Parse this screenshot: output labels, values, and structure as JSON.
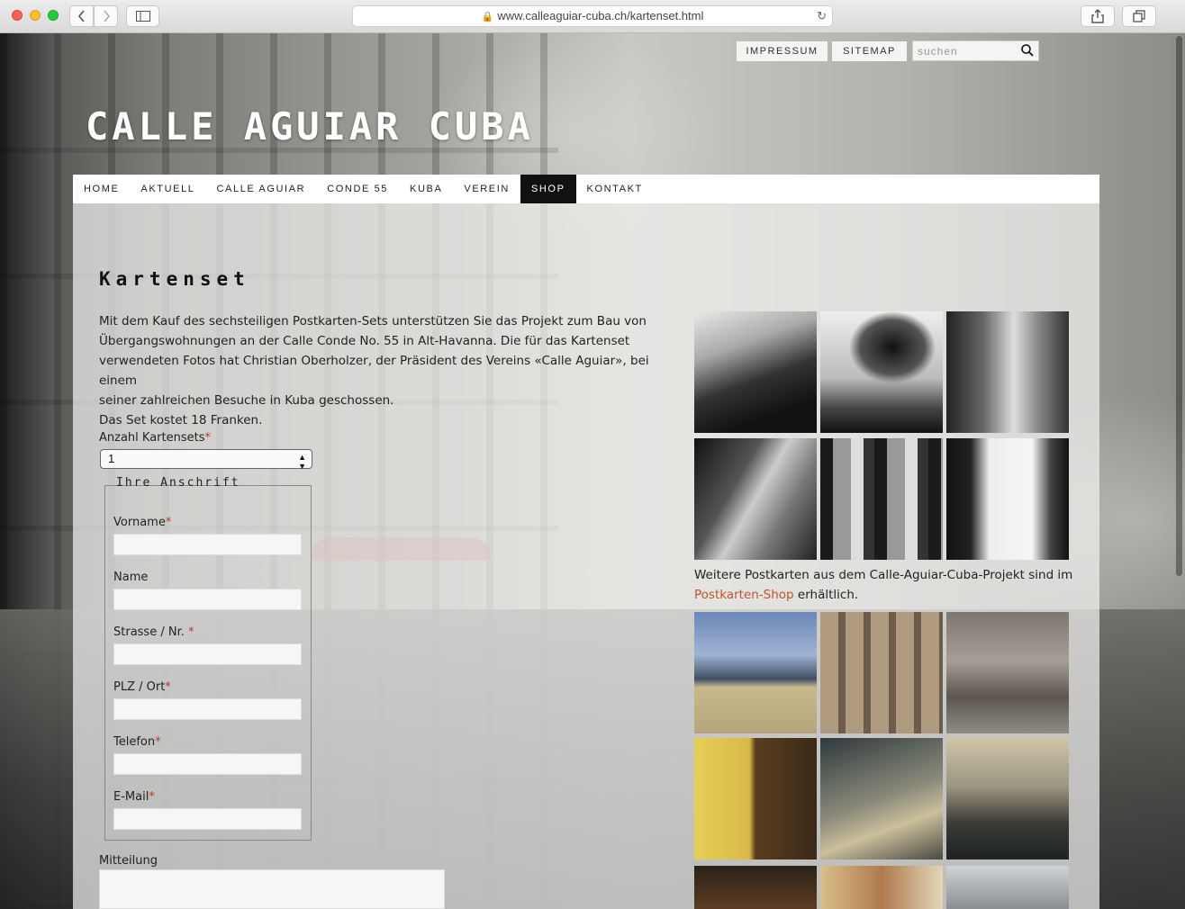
{
  "browser": {
    "url": "www.calleaguiar-cuba.ch/kartenset.html"
  },
  "header": {
    "impressum": "IMPRESSUM",
    "sitemap": "SITEMAP",
    "search_placeholder": "suchen",
    "site_title": "CALLE AGUIAR CUBA"
  },
  "nav": {
    "items": [
      "HOME",
      "AKTUELL",
      "CALLE AGUIAR",
      "CONDE 55",
      "KUBA",
      "VEREIN",
      "SHOP",
      "KONTAKT"
    ],
    "active": "SHOP"
  },
  "main": {
    "title": "Kartenset",
    "intro_lines": [
      "Mit dem Kauf des sechsteiligen Postkarten-Sets unterstützen Sie das Projekt zum Bau von",
      "Übergangswohnungen an der Calle Conde No. 55 in Alt-Havanna. Die für das Kartenset",
      "verwendeten Fotos hat Christian Oberholzer, der Präsident des Vereins «Calle Aguiar», bei einem",
      "seiner zahlreichen Besuche in Kuba geschossen.",
      "Das Set kostet 18 Franken."
    ],
    "quantity_label": "Anzahl Kartensets",
    "quantity_value": "1",
    "required_mark": "*",
    "address_legend": "Ihre Anschrift",
    "fields": {
      "vorname": "Vorname",
      "name": "Name",
      "strasse": "Strasse / Nr.",
      "plz": "PLZ / Ort",
      "telefon": "Telefon",
      "email": "E-Mail"
    },
    "message_label": "Mitteilung"
  },
  "sidebar": {
    "more_text_before": "Weitere Postkarten aus dem Calle-Aguiar-Cuba-Projekt sind im",
    "more_link": "Postkarten-Shop",
    "more_text_after": " erhältlich."
  }
}
